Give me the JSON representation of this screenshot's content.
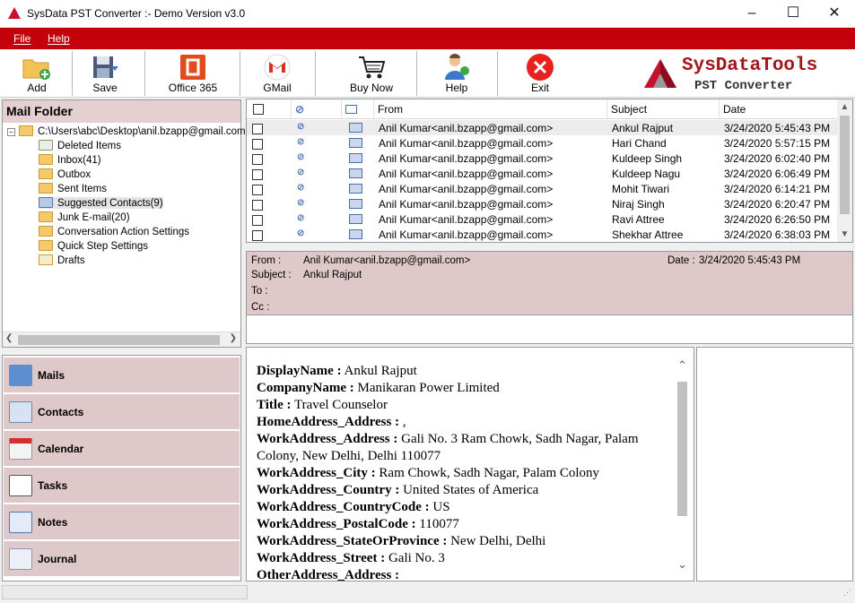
{
  "window": {
    "title": "SysData PST Converter :- Demo Version v3.0",
    "minimize": "–",
    "maximize": "☐",
    "close": "✕"
  },
  "menu": {
    "file": "File",
    "help": "Help"
  },
  "toolbar": {
    "add": "Add",
    "save": "Save",
    "office365": "Office 365",
    "gmail": "GMail",
    "buy_now": "Buy Now",
    "help": "Help",
    "exit": "Exit"
  },
  "brand": {
    "name": "SysDataTools",
    "product": "PST Converter"
  },
  "mail_folder": {
    "title": "Mail Folder",
    "root": "C:\\Users\\abc\\Desktop\\anil.bzapp@gmail.com",
    "items": [
      "Deleted Items",
      "Inbox(41)",
      "Outbox",
      "Sent Items",
      "Suggested Contacts(9)",
      "Junk E-mail(20)",
      "Conversation Action Settings",
      "Quick Step Settings",
      "Drafts"
    ]
  },
  "nav": {
    "mails": "Mails",
    "contacts": "Contacts",
    "calendar": "Calendar",
    "tasks": "Tasks",
    "notes": "Notes",
    "journal": "Journal"
  },
  "list": {
    "headers": {
      "from": "From",
      "subject": "Subject",
      "date": "Date"
    },
    "rows": [
      {
        "from": "Anil Kumar<anil.bzapp@gmail.com>",
        "subject": "Ankul Rajput",
        "date": "3/24/2020 5:45:43 PM"
      },
      {
        "from": "Anil Kumar<anil.bzapp@gmail.com>",
        "subject": "Hari Chand",
        "date": "3/24/2020 5:57:15 PM"
      },
      {
        "from": "Anil Kumar<anil.bzapp@gmail.com>",
        "subject": "Kuldeep Singh",
        "date": "3/24/2020 6:02:40 PM"
      },
      {
        "from": "Anil Kumar<anil.bzapp@gmail.com>",
        "subject": "Kuldeep Nagu",
        "date": "3/24/2020 6:06:49 PM"
      },
      {
        "from": "Anil Kumar<anil.bzapp@gmail.com>",
        "subject": "Mohit Tiwari",
        "date": "3/24/2020 6:14:21 PM"
      },
      {
        "from": "Anil Kumar<anil.bzapp@gmail.com>",
        "subject": "Niraj Singh",
        "date": "3/24/2020 6:20:47 PM"
      },
      {
        "from": "Anil Kumar<anil.bzapp@gmail.com>",
        "subject": "Ravi Attree",
        "date": "3/24/2020 6:26:50 PM"
      },
      {
        "from": "Anil Kumar<anil.bzapp@gmail.com>",
        "subject": "Shekhar Attree",
        "date": "3/24/2020 6:38:03 PM"
      }
    ]
  },
  "header": {
    "from_label": "From :",
    "from_value": "Anil Kumar<anil.bzapp@gmail.com>",
    "date_label": "Date :",
    "date_value": "3/24/2020 5:45:43 PM",
    "subject_label": "Subject :",
    "subject_value": "Ankul Rajput",
    "to_label": "To :",
    "cc_label": "Cc :"
  },
  "details": [
    {
      "key": "DisplayName :",
      "value": " Ankul Rajput"
    },
    {
      "key": "CompanyName :",
      "value": " Manikaran Power Limited"
    },
    {
      "key": "Title :",
      "value": " Travel Counselor"
    },
    {
      "key": "HomeAddress_Address :",
      "value": " ,"
    },
    {
      "key": "WorkAddress_Address :",
      "value": " Gali No. 3 Ram Chowk, Sadh Nagar, Palam Colony, New Delhi, Delhi 110077"
    },
    {
      "key": "WorkAddress_City :",
      "value": " Ram Chowk, Sadh Nagar, Palam Colony"
    },
    {
      "key": "WorkAddress_Country :",
      "value": " United States of America"
    },
    {
      "key": "WorkAddress_CountryCode :",
      "value": " US"
    },
    {
      "key": "WorkAddress_PostalCode :",
      "value": " 110077"
    },
    {
      "key": "WorkAddress_StateOrProvince :",
      "value": " New Delhi, Delhi"
    },
    {
      "key": "WorkAddress_Street :",
      "value": " Gali No. 3"
    },
    {
      "key": "OtherAddress_Address :",
      "value": ""
    }
  ]
}
